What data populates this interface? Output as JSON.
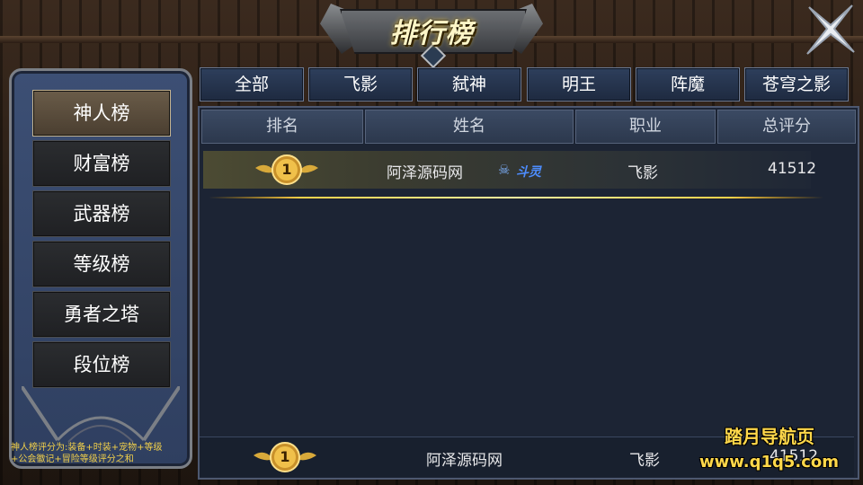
{
  "window": {
    "title": "排行榜"
  },
  "left_menu": {
    "items": [
      {
        "label": "神人榜",
        "active": true
      },
      {
        "label": "财富榜",
        "active": false
      },
      {
        "label": "武器榜",
        "active": false
      },
      {
        "label": "等级榜",
        "active": false
      },
      {
        "label": "勇者之塔",
        "active": false
      },
      {
        "label": "段位榜",
        "active": false
      }
    ],
    "note_line1": "神人榜评分为:装备+时装+宠物+等级",
    "note_line2": "+公会徽记+冒险等级评分之和"
  },
  "tabs": [
    "全部",
    "飞影",
    "弑神",
    "明王",
    "阵魔",
    "苍穹之影"
  ],
  "table": {
    "columns": [
      "排名",
      "姓名",
      "职业",
      "总评分"
    ],
    "rows": [
      {
        "rank": "1",
        "name": "阿泽源码网",
        "title_badge": "斗灵",
        "job": "飞影",
        "score": "41512"
      }
    ]
  },
  "self_row": {
    "rank": "1",
    "name": "阿泽源码网",
    "job": "飞影",
    "score": "41512"
  },
  "watermark": {
    "line1": "踏月导航页",
    "line2": "www.q1q5.com"
  },
  "colors": {
    "accent_gold": "#f2d04a",
    "panel_blue": "#1c2434",
    "badge_blue": "#3b7dff"
  },
  "icons": {
    "close": "close-icon",
    "medal": "rank-medal-icon",
    "badge": "skull-icon"
  }
}
